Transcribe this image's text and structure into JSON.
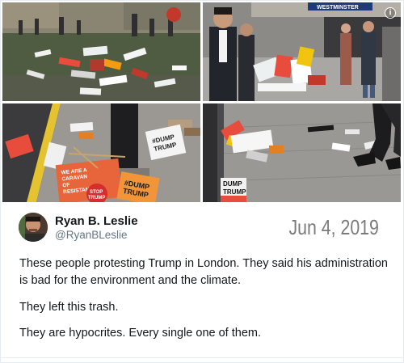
{
  "tweet": {
    "display_name": "Ryan B. Leslie",
    "handle": "@RyanBLeslie",
    "date": "Jun 4, 2019",
    "paragraphs": [
      "These people protesting Trump in London. They said his administration is bad for the environment and the climate.",
      "They left this trash.",
      "They are hypocrites. Every single one of them."
    ]
  },
  "photos": {
    "top_right_sign": "WESTMINSTER",
    "placard_1": [
      "WE ARE A",
      "CARAVAN",
      "OF",
      "RESISTANCE"
    ],
    "placard_2": [
      "STOP",
      "TRUMP"
    ],
    "placard_3": [
      "#DUMP",
      "TRUMP"
    ],
    "placard_4": [
      "DUMP",
      "TRUMP"
    ],
    "info_icon": "i"
  },
  "icons": {
    "info": "info-icon",
    "avatar": "avatar"
  },
  "colors": {
    "name": "#14171a",
    "handle": "#657786",
    "date": "#7a7a7a",
    "border": "#e6ecf0"
  }
}
